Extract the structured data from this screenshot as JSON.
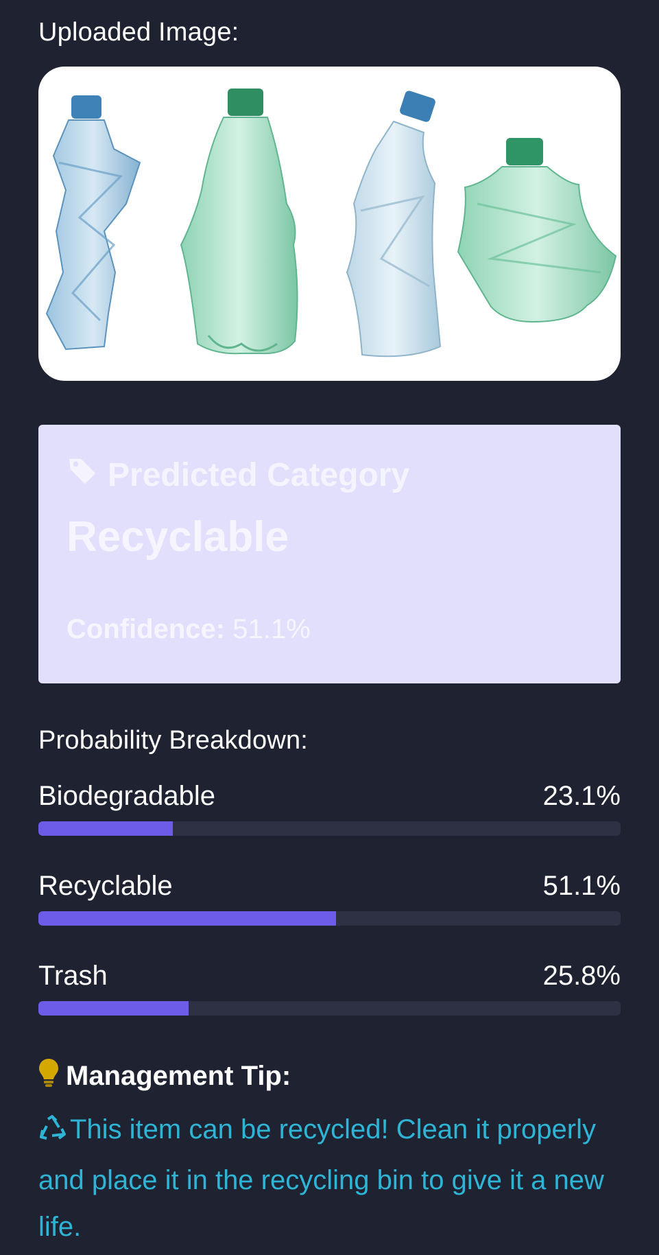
{
  "uploaded": {
    "title": "Uploaded Image:"
  },
  "prediction": {
    "label": "Predicted Category",
    "value": "Recyclable",
    "confidence_label": "Confidence:",
    "confidence_value": "51.1%",
    "icon": "tag-icon"
  },
  "breakdown": {
    "title": "Probability Breakdown:",
    "items": [
      {
        "name": "Biodegradable",
        "percent": "23.1%",
        "value": 23.1
      },
      {
        "name": "Recyclable",
        "percent": "51.1%",
        "value": 51.1
      },
      {
        "name": "Trash",
        "percent": "25.8%",
        "value": 25.8
      }
    ]
  },
  "tip": {
    "title": "Management Tip:",
    "title_icon": "lightbulb-icon",
    "text_icon": "recycle-icon",
    "text": "This item can be recycled! Clean it properly and place it in the recycling bin to give it a new life."
  },
  "colors": {
    "background": "#1e2231",
    "card": "#e2dffc",
    "bar_fill": "#6c5ce7",
    "bar_track": "#2d3143",
    "tip_text": "#2eb5d6",
    "bulb": "#d4a800"
  }
}
